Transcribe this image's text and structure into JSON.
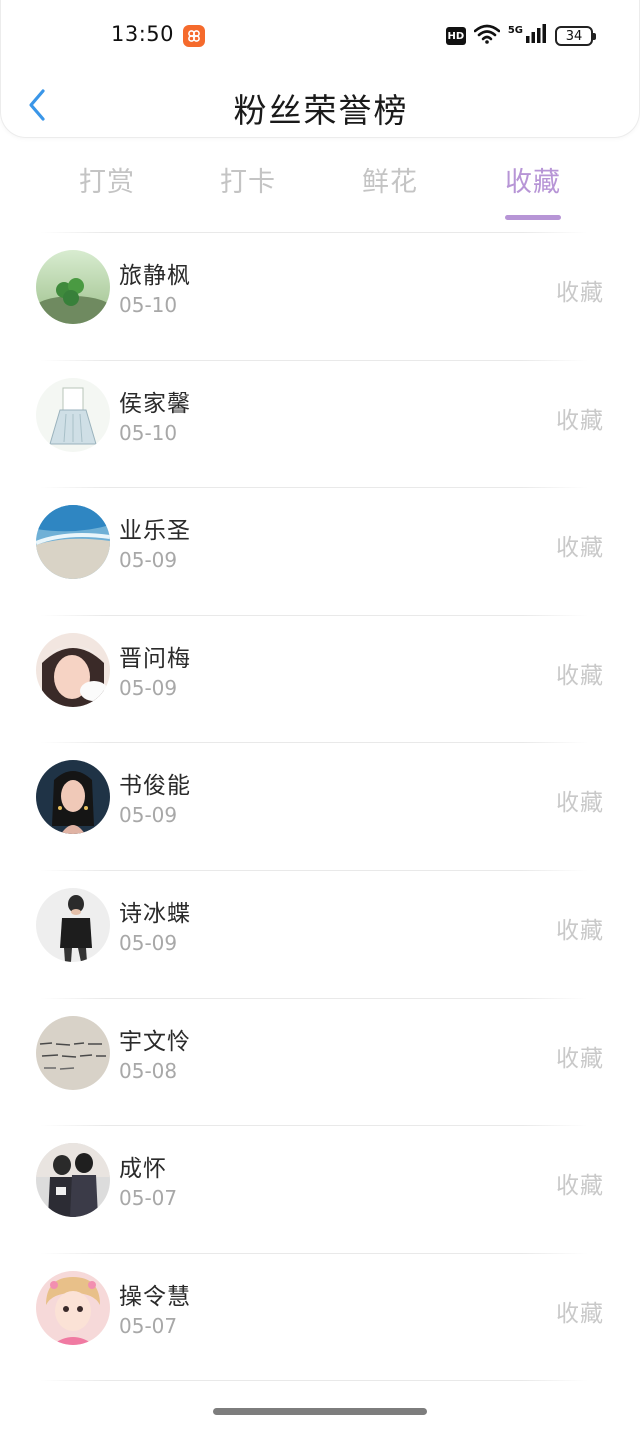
{
  "status_bar": {
    "time": "13:50",
    "network": "5G",
    "hd": "HD",
    "battery": "34",
    "icons": [
      "app-notification-icon",
      "wifi-icon",
      "signal-icon",
      "battery-icon"
    ]
  },
  "header": {
    "title": "粉丝荣誉榜",
    "back_icon": "chevron-left-icon"
  },
  "tabs": [
    {
      "label": "打赏",
      "active": false
    },
    {
      "label": "打卡",
      "active": false
    },
    {
      "label": "鲜花",
      "active": false
    },
    {
      "label": "收藏",
      "active": true
    }
  ],
  "colors": {
    "accent": "#b795d6",
    "back_arrow": "#3a96e8",
    "inactive_tab": "#c4c4c4",
    "action_text": "#c9c9c9"
  },
  "fans": [
    {
      "name": "旅静枫",
      "date": "05-10",
      "action": "收藏",
      "avatar": "clover-photo"
    },
    {
      "name": "侯家馨",
      "date": "05-10",
      "action": "收藏",
      "avatar": "dress-sketch"
    },
    {
      "name": "业乐圣",
      "date": "05-09",
      "action": "收藏",
      "avatar": "ocean-waves"
    },
    {
      "name": "晋问梅",
      "date": "05-09",
      "action": "收藏",
      "avatar": "girl-selfie"
    },
    {
      "name": "书俊能",
      "date": "05-09",
      "action": "收藏",
      "avatar": "illustrated-girl"
    },
    {
      "name": "诗冰蝶",
      "date": "05-09",
      "action": "收藏",
      "avatar": "man-black-shirt"
    },
    {
      "name": "宇文怜",
      "date": "05-08",
      "action": "收藏",
      "avatar": "handwriting-note"
    },
    {
      "name": "成怀",
      "date": "05-07",
      "action": "收藏",
      "avatar": "couple-photo"
    },
    {
      "name": "操令慧",
      "date": "05-07",
      "action": "收藏",
      "avatar": "cute-girl-pink"
    }
  ]
}
